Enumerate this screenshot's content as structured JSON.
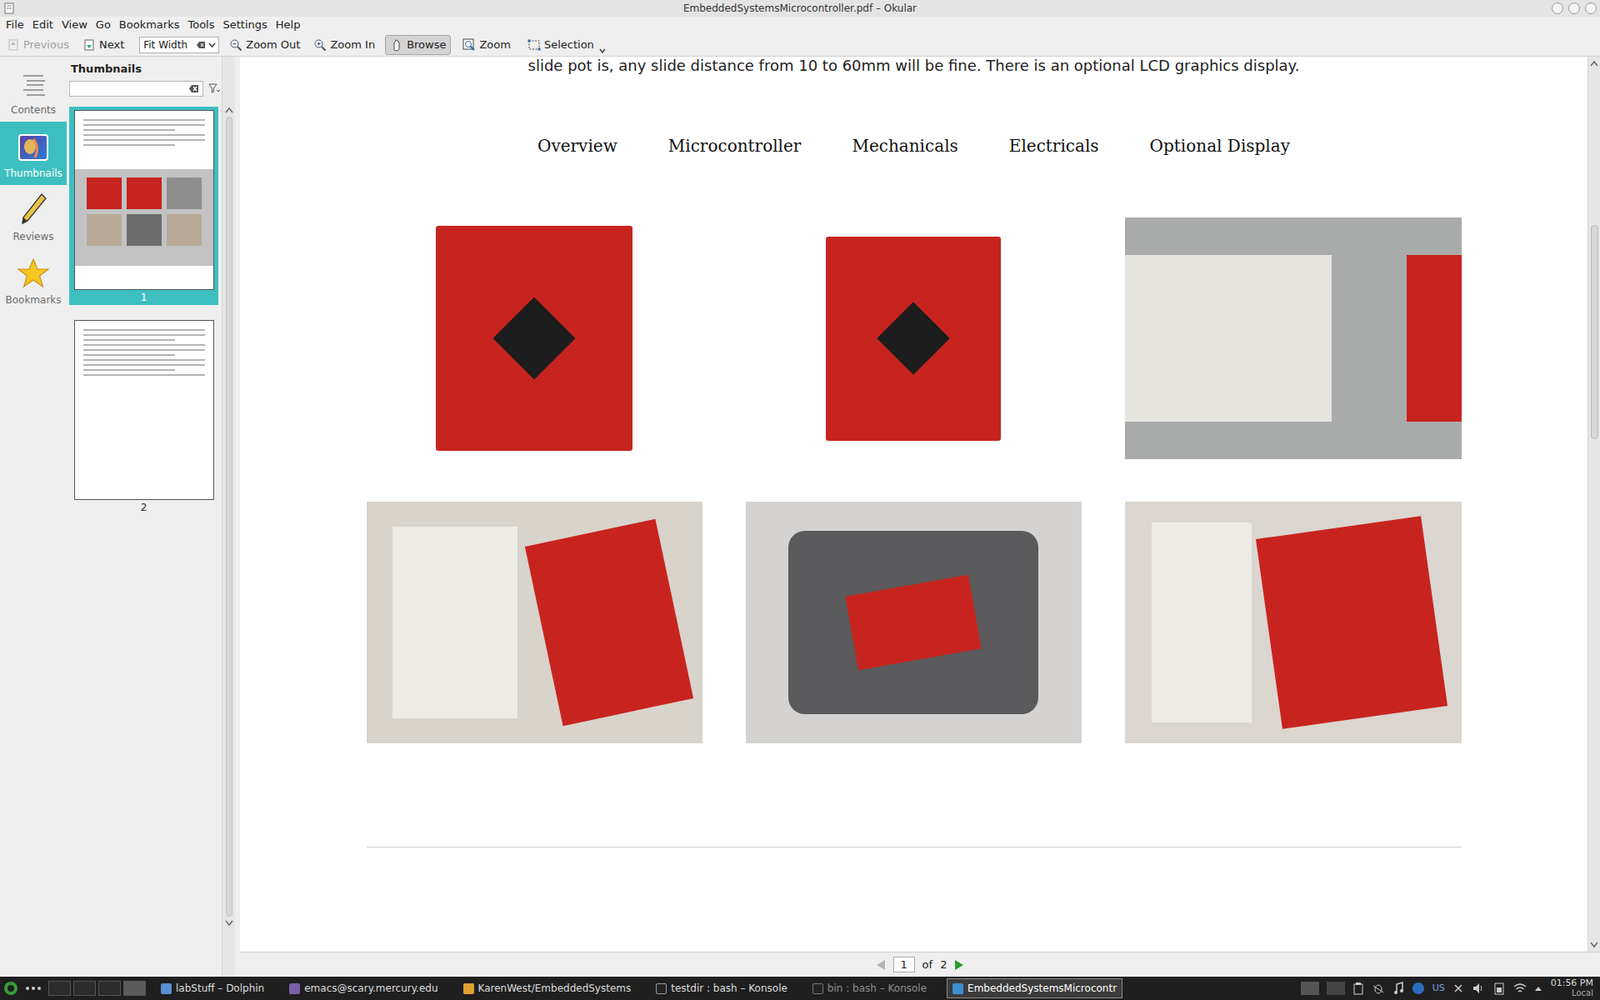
{
  "window": {
    "title": "EmbeddedSystemsMicrocontroller.pdf – Okular"
  },
  "menu": [
    "File",
    "Edit",
    "View",
    "Go",
    "Bookmarks",
    "Tools",
    "Settings",
    "Help"
  ],
  "toolbar": {
    "previous": {
      "label": "Previous",
      "disabled": true
    },
    "next": {
      "label": "Next",
      "disabled": false
    },
    "zoom_mode": "Fit Width",
    "zoom_out": "Zoom Out",
    "zoom_in": "Zoom In",
    "tools": [
      {
        "label": "Browse",
        "selected": true
      },
      {
        "label": "Zoom",
        "selected": false
      },
      {
        "label": "Selection",
        "selected": false
      }
    ]
  },
  "sidebar": {
    "items": [
      {
        "label": "Contents",
        "selected": false
      },
      {
        "label": "Thumbnails",
        "selected": true
      },
      {
        "label": "Reviews",
        "selected": false
      },
      {
        "label": "Bookmarks",
        "selected": false
      }
    ]
  },
  "thumbnails": {
    "title": "Thumbnails",
    "filter": "",
    "pages": [
      {
        "label": "1",
        "selected": true
      },
      {
        "label": "2",
        "selected": false
      }
    ]
  },
  "document": {
    "top_text": "slide pot is, any slide distance from 10 to 60mm will be fine. There is an optional LCD graphics display.",
    "nav": [
      "Overview",
      "Microcontroller",
      "Mechanicals",
      "Electricals",
      "Optional Display"
    ]
  },
  "page_nav": {
    "current": "1",
    "of": "of",
    "total": "2",
    "prev_disabled": true
  },
  "taskbar": {
    "tasks": [
      {
        "label": "labStuff – Dolphin",
        "selected": false
      },
      {
        "label": "emacs@scary.mercury.edu",
        "selected": false
      },
      {
        "label": "KarenWest/EmbeddedSystems",
        "selected": false
      },
      {
        "label": "testdir : bash – Konsole",
        "selected": false
      },
      {
        "label": "bin : bash – Konsole",
        "selected": false
      },
      {
        "label": "EmbeddedSystemsMicrocontr",
        "selected": true
      }
    ],
    "layout": "US",
    "clock": "01:56 PM",
    "zone": "Local"
  }
}
